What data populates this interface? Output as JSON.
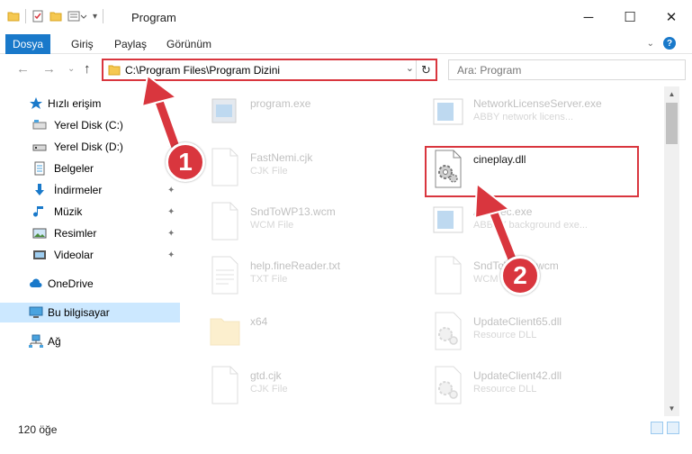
{
  "window": {
    "title": "Program"
  },
  "ribbon": {
    "tabs": [
      "Dosya",
      "Giriş",
      "Paylaş",
      "Görünüm"
    ]
  },
  "address": {
    "path": "C:\\Program Files\\Program Dizini"
  },
  "search": {
    "placeholder": "Ara: Program"
  },
  "sidebar": {
    "items": [
      {
        "label": "Hızlı erişim"
      },
      {
        "label": "Yerel Disk (C:)"
      },
      {
        "label": "Yerel Disk (D:)"
      },
      {
        "label": "Belgeler"
      },
      {
        "label": "İndirmeler"
      },
      {
        "label": "Müzik"
      },
      {
        "label": "Resimler"
      },
      {
        "label": "Videolar"
      },
      {
        "label": "OneDrive"
      },
      {
        "label": "Bu bilgisayar"
      },
      {
        "label": "Ağ"
      }
    ]
  },
  "files": [
    {
      "name": "program.exe",
      "type": ""
    },
    {
      "name": "NetworkLicenseServer.exe",
      "type": "ABBY network licens..."
    },
    {
      "name": "FastNemi.cjk",
      "type": "CJK File"
    },
    {
      "name": "cineplay.dll",
      "type": ""
    },
    {
      "name": "SndToWP13.wcm",
      "type": "WCM File"
    },
    {
      "name": "ASExec.exe",
      "type": "ABBYY background exe..."
    },
    {
      "name": "help.fineReader.txt",
      "type": "TXT File"
    },
    {
      "name": "SndToWP14.wcm",
      "type": "WCM File"
    },
    {
      "name": "x64",
      "type": ""
    },
    {
      "name": "UpdateClient65.dll",
      "type": "Resource DLL"
    },
    {
      "name": "gtd.cjk",
      "type": "CJK File"
    },
    {
      "name": "UpdateClient42.dll",
      "type": "Resource DLL"
    }
  ],
  "status": {
    "count": "120 öğe"
  },
  "annotations": {
    "badge1": "1",
    "badge2": "2"
  },
  "colors": {
    "accent": "#1979ca",
    "highlight": "#d9363e",
    "selected": "#cce8ff"
  }
}
